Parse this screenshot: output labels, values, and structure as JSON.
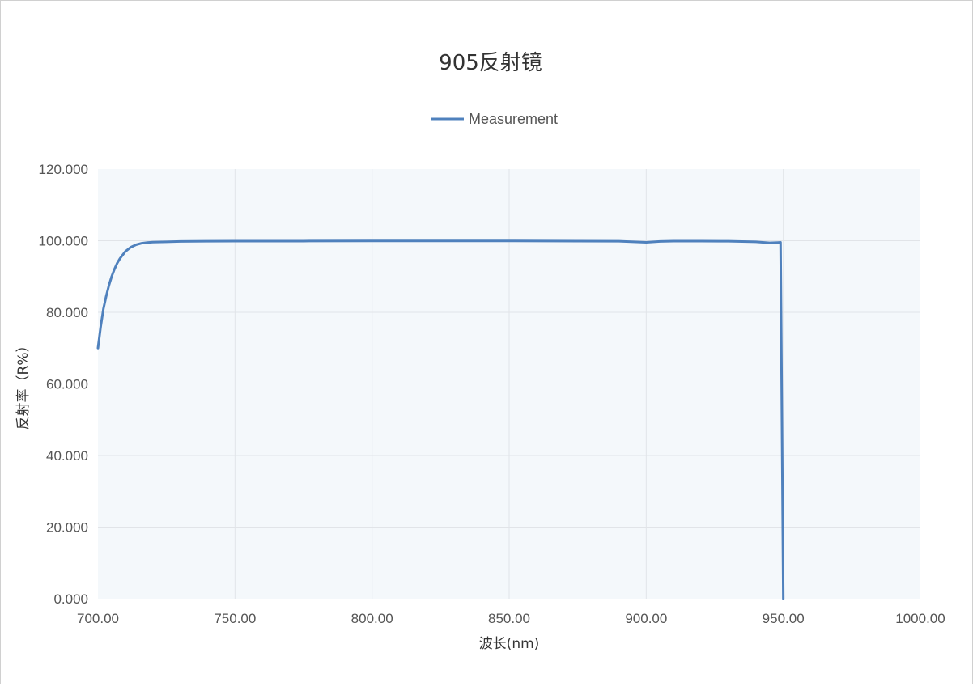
{
  "chart_data": {
    "type": "line",
    "title": "905反射镜",
    "xlabel": "波长(nm)",
    "ylabel": "反射率（R%）",
    "xlim": [
      700,
      1000
    ],
    "ylim": [
      0,
      120
    ],
    "xticks": [
      700,
      750,
      800,
      850,
      900,
      950,
      1000
    ],
    "yticks": [
      0,
      20,
      40,
      60,
      80,
      100,
      120
    ],
    "xtick_labels": [
      "700.00",
      "750.00",
      "800.00",
      "850.00",
      "900.00",
      "950.00",
      "1000.00"
    ],
    "ytick_labels": [
      "0.000",
      "20.000",
      "40.000",
      "60.000",
      "80.000",
      "100.000",
      "120.000"
    ],
    "grid": true,
    "legend": "top-center",
    "colors": {
      "series": "#4f81bd",
      "plot_bg": "#f4f8fb",
      "grid": "#e1e4e8"
    },
    "series": [
      {
        "name": "Measurement",
        "x": [
          700,
          701,
          702,
          703,
          704,
          705,
          706,
          707,
          708,
          709,
          710,
          712,
          714,
          716,
          718,
          720,
          725,
          730,
          740,
          750,
          775,
          800,
          825,
          850,
          875,
          890,
          900,
          905,
          910,
          920,
          930,
          940,
          945,
          948,
          949,
          949.5,
          950
        ],
        "y": [
          70,
          76,
          81,
          84.5,
          87.5,
          90,
          92,
          93.7,
          95,
          96,
          97,
          98.2,
          98.9,
          99.3,
          99.5,
          99.6,
          99.7,
          99.8,
          99.85,
          99.9,
          99.9,
          99.95,
          99.95,
          99.95,
          99.9,
          99.85,
          99.55,
          99.8,
          99.9,
          99.9,
          99.85,
          99.7,
          99.4,
          99.5,
          99.55,
          50,
          0
        ]
      }
    ]
  }
}
